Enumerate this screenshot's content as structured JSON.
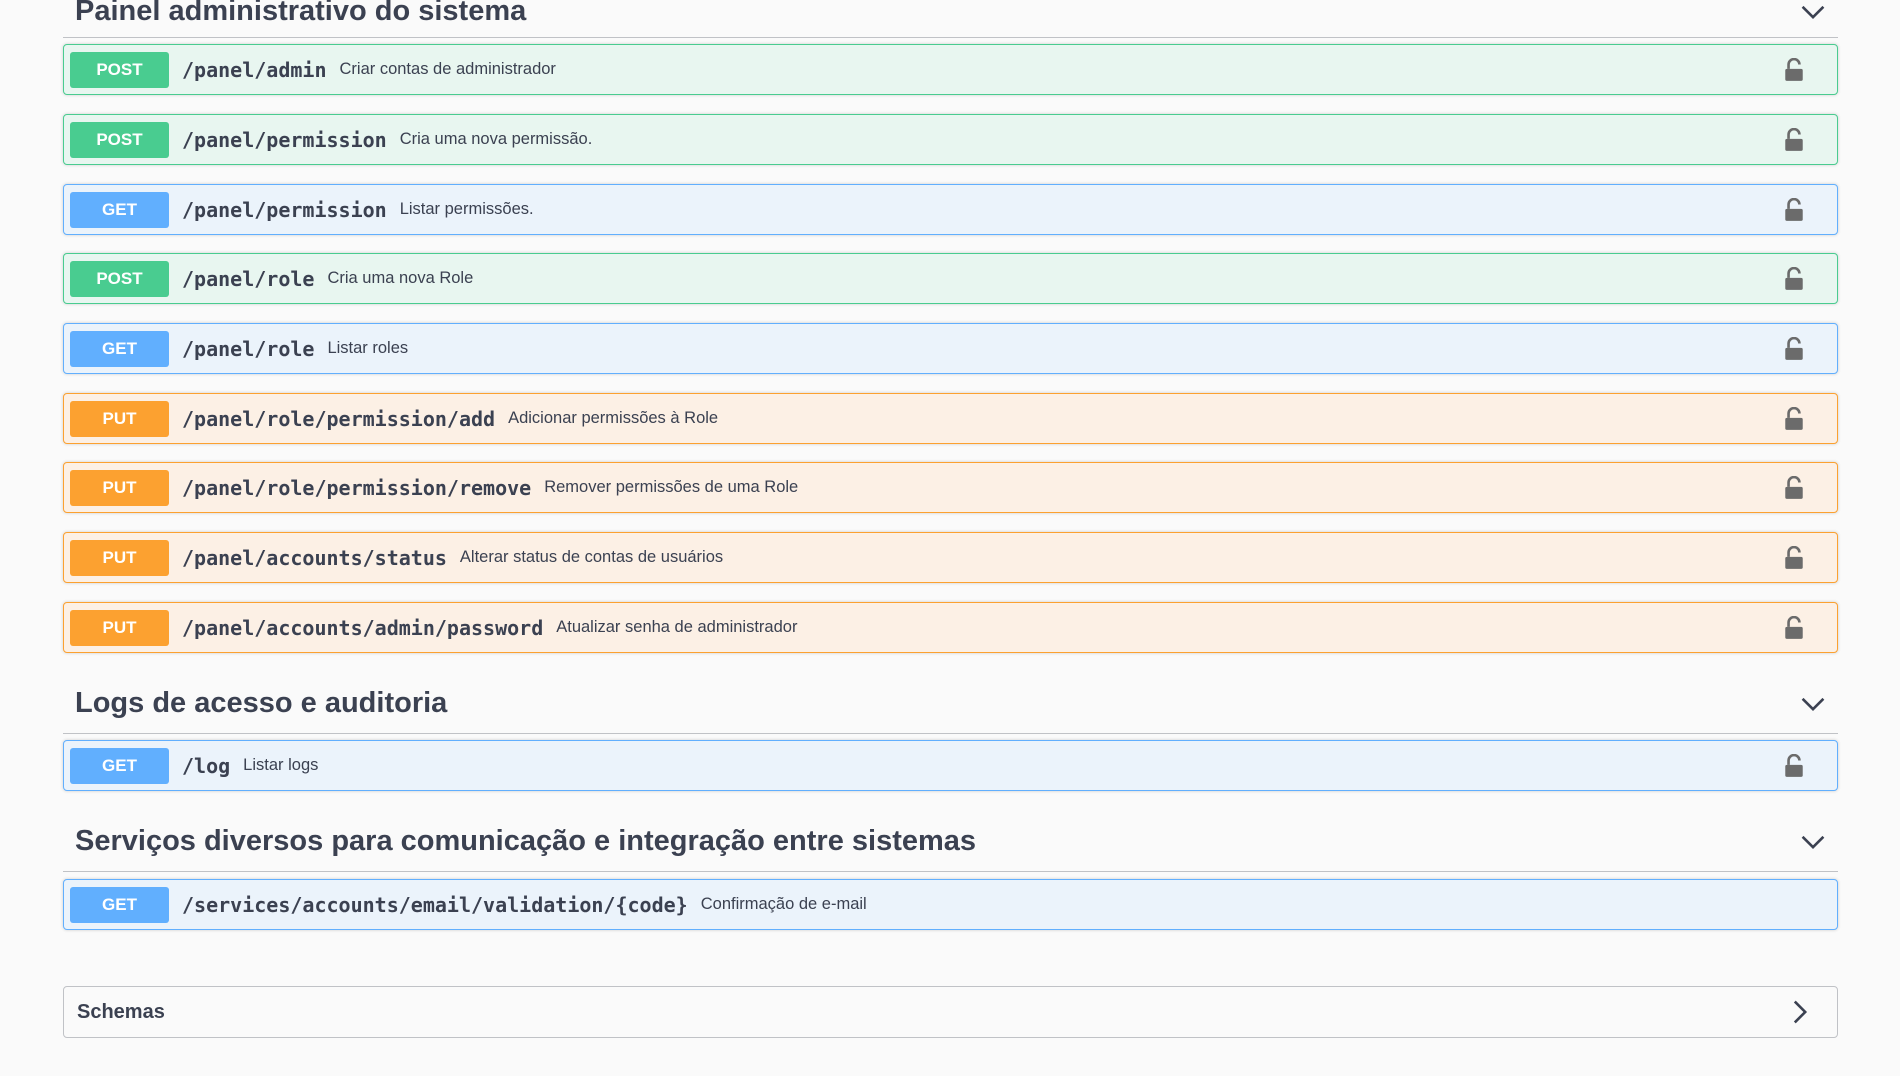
{
  "sections": [
    {
      "title": "Painel administrativo do sistema",
      "operations": [
        {
          "method": "POST",
          "path": "/panel/admin",
          "summary": "Criar contas de administrador"
        },
        {
          "method": "POST",
          "path": "/panel/permission",
          "summary": "Cria uma nova permissão."
        },
        {
          "method": "GET",
          "path": "/panel/permission",
          "summary": "Listar permissões."
        },
        {
          "method": "POST",
          "path": "/panel/role",
          "summary": "Cria uma nova Role"
        },
        {
          "method": "GET",
          "path": "/panel/role",
          "summary": "Listar roles"
        },
        {
          "method": "PUT",
          "path": "/panel/role/permission/add",
          "summary": "Adicionar permissões à Role"
        },
        {
          "method": "PUT",
          "path": "/panel/role/permission/remove",
          "summary": "Remover permissões de uma Role"
        },
        {
          "method": "PUT",
          "path": "/panel/accounts/status",
          "summary": "Alterar status de contas de usuários"
        },
        {
          "method": "PUT",
          "path": "/panel/accounts/admin/password",
          "summary": "Atualizar senha de administrador"
        }
      ]
    },
    {
      "title": "Logs de acesso e auditoria",
      "operations": [
        {
          "method": "GET",
          "path": "/log",
          "summary": "Listar logs"
        }
      ]
    },
    {
      "title": "Serviços diversos para comunicação e integração entre sistemas",
      "operations": [
        {
          "method": "GET",
          "path": "/services/accounts/email/validation/{code}",
          "summary": "Confirmação de e-mail"
        }
      ]
    }
  ],
  "schemas": {
    "title": "Schemas"
  },
  "icons": {
    "lock": "lock-icon",
    "expand": "chevron-down-icon",
    "schemas_expand": "chevron-right-icon"
  },
  "colors": {
    "post": "#49cc90",
    "get": "#61affe",
    "put": "#fca130",
    "text": "#3b4151"
  }
}
